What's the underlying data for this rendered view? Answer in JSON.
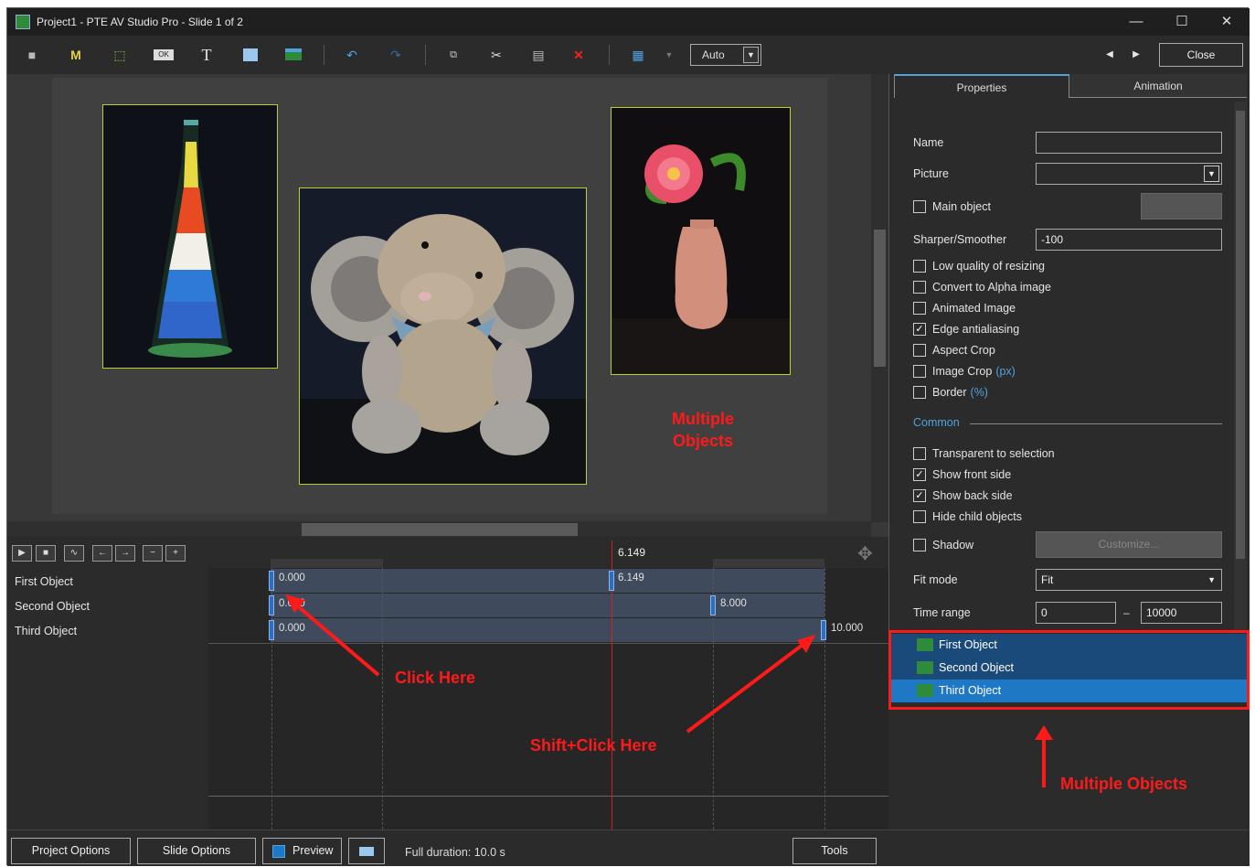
{
  "window": {
    "title": "Project1 - PTE AV Studio Pro - Slide 1 of 2"
  },
  "toolbar": {
    "zoom_value": "Auto",
    "close_label": "Close",
    "m_label": "M",
    "t_label": "T",
    "ok_label": "OK"
  },
  "timeline": {
    "cursor_time": "6.149",
    "tracks": [
      {
        "name": "First Object",
        "start": "0.000",
        "mid": "6.149"
      },
      {
        "name": "Second Object",
        "start": "0.000",
        "end": "8.000"
      },
      {
        "name": "Third Object",
        "start": "0.000",
        "end": "10.000"
      }
    ]
  },
  "properties": {
    "tabs": [
      "Properties",
      "Animation"
    ],
    "name_label": "Name",
    "name_value": "",
    "picture_label": "Picture",
    "main_object_label": "Main object",
    "sharper_label": "Sharper/Smoother",
    "sharper_value": "-100",
    "checkboxes": [
      {
        "label": "Low quality of resizing",
        "checked": false
      },
      {
        "label": "Convert to Alpha image",
        "checked": false
      },
      {
        "label": "Animated Image",
        "checked": false
      },
      {
        "label": "Edge antialiasing",
        "checked": true
      },
      {
        "label": "Aspect Crop",
        "checked": false
      },
      {
        "label": "Image Crop",
        "hint": "(px)",
        "checked": false
      },
      {
        "label": "Border",
        "hint": "(%)",
        "checked": false
      }
    ],
    "common_label": "Common",
    "common_checkboxes": [
      {
        "label": "Transparent to selection",
        "checked": false
      },
      {
        "label": "Show front side",
        "checked": true
      },
      {
        "label": "Show back side",
        "checked": true
      },
      {
        "label": "Hide child objects",
        "checked": false
      }
    ],
    "shadow_label": "Shadow",
    "customize_label": "Customize...",
    "fit_mode_label": "Fit mode",
    "fit_mode_value": "Fit",
    "time_range_label": "Time range",
    "time_range_from": "0",
    "time_range_dash": "–",
    "time_range_to": "10000"
  },
  "object_list": [
    "First Object",
    "Second Object",
    "Third Object"
  ],
  "bottom": {
    "project_options": "Project Options",
    "slide_options": "Slide Options",
    "preview": "Preview",
    "full_duration": "Full duration: 10.0 s",
    "tools": "Tools"
  },
  "annotations": {
    "multiple_objects_canvas_1": "Multiple",
    "multiple_objects_canvas_2": "Objects",
    "click_here": "Click Here",
    "shift_click_here": "Shift+Click Here",
    "multiple_objects_list": "Multiple Objects"
  },
  "colors": {
    "accent": "#2c6ebf",
    "selection": "#1a5a96",
    "annotation": "#ff1a1a",
    "frame": "#b8d030"
  }
}
